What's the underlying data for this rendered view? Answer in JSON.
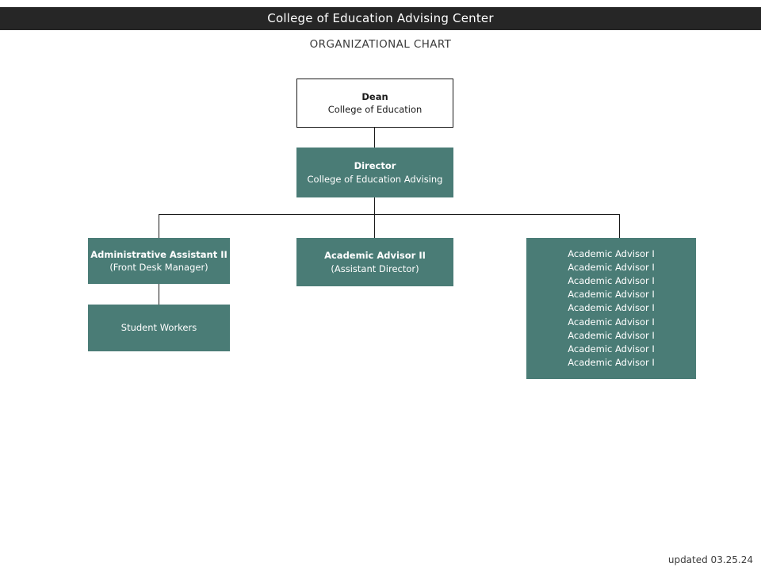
{
  "header": {
    "title": "College of Education Advising Center",
    "bar_color": "#262626",
    "text_color": "#ffffff"
  },
  "subtitle": "ORGANIZATIONAL CHART",
  "theme": {
    "accent_teal": "#4a7c76",
    "line_color": "#1a1a1a",
    "box_white": "#ffffff",
    "page_background": "#ffffff"
  },
  "chart": {
    "type": "org-chart",
    "nodes": {
      "dean": {
        "line1": "Dean",
        "line2": "College of Education",
        "style": "white"
      },
      "director": {
        "line1": "Director",
        "line2": "College of Education Advising",
        "style": "teal"
      },
      "admin_assistant": {
        "line1": "Administrative Assistant II",
        "line2": "(Front Desk Manager)",
        "style": "teal"
      },
      "student_workers": {
        "line1": "Student Workers",
        "style": "teal"
      },
      "academic_advisor_2": {
        "line1": "Academic Advisor II",
        "line2": "(Assistant Director)",
        "style": "teal"
      },
      "academic_advisor_1_list": {
        "style": "teal",
        "items": [
          "Academic Advisor I",
          "Academic Advisor I",
          "Academic Advisor I",
          "Academic Advisor I",
          "Academic Advisor I",
          "Academic Advisor I",
          "Academic Advisor I",
          "Academic Advisor I",
          "Academic Advisor I"
        ],
        "count": 9
      }
    },
    "edges": [
      {
        "from": "dean",
        "to": "director"
      },
      {
        "from": "director",
        "to": "admin_assistant"
      },
      {
        "from": "director",
        "to": "academic_advisor_2"
      },
      {
        "from": "director",
        "to": "academic_advisor_1_list"
      },
      {
        "from": "admin_assistant",
        "to": "student_workers"
      }
    ]
  },
  "footer": {
    "updated": "updated 03.25.24"
  }
}
